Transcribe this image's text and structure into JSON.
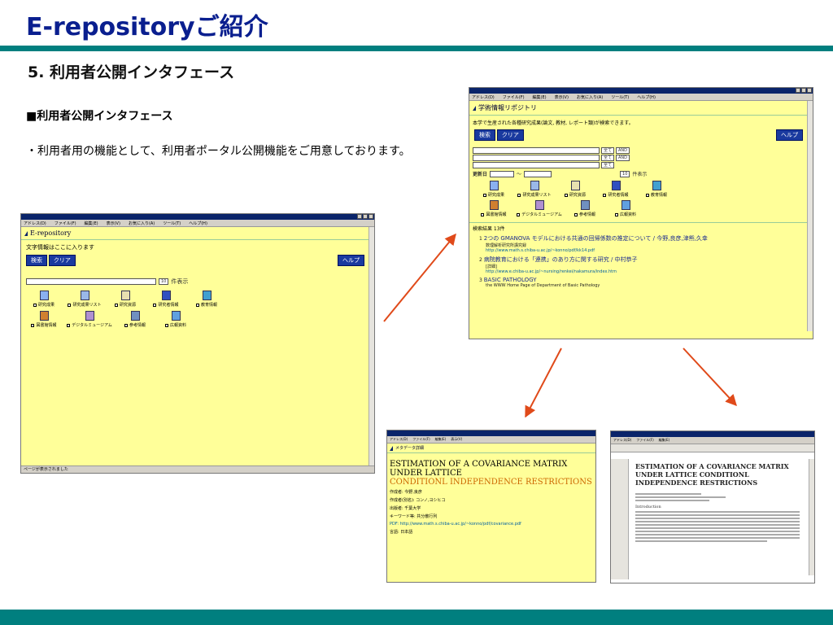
{
  "slide": {
    "title": "E-repositoryご紹介",
    "subtitle": "5. 利用者公開インタフェース",
    "section_head": "■利用者公開インタフェース",
    "bullet": "・利用者用の機能として、利用者ポータル公開機能をご用意しております。"
  },
  "colors": {
    "title": "#0a1f8f",
    "bar": "#007f7f",
    "arrow": "#e04a1a",
    "page_bg": "#ffff99"
  },
  "browser_menu": [
    "アドレス(D)",
    "ファイル(F)",
    "編集(E)",
    "表示(V)",
    "お気に入り(A)",
    "ツール(T)",
    "ヘルプ(H)"
  ],
  "shot_main": {
    "page_title": "E-repository",
    "prompt": "文字情報はここに入ります",
    "search_btn": "検索",
    "clear_btn": "クリア",
    "help_btn": "ヘルプ",
    "count_select": "10",
    "count_label": "件表示",
    "status": "ページが表示されました",
    "categories_row1": [
      "研究成果",
      "研究成果リスト",
      "研究資源",
      "研究者情報",
      "教育情報"
    ],
    "categories_row2": [
      "図書館情報",
      "デジタルミュージアム",
      "参考情報",
      "広報資料"
    ]
  },
  "shot_search": {
    "page_title": "学術情報リポジトリ",
    "description": "本学で生産された各種研究成果(論文, 教材, レポート類)が検索できます。",
    "search_btn": "検索",
    "clear_btn": "クリア",
    "help_btn": "ヘルプ",
    "select_all": "全て",
    "select_and": "AND",
    "date_label": "更新日",
    "range_sep": "〜",
    "count_select": "10",
    "count_label": "件表示",
    "categories_row1": [
      "研究成果",
      "研究成果リスト",
      "研究資源",
      "研究者情報",
      "教育情報"
    ],
    "categories_row2": [
      "図書館情報",
      "デジタルミュージアム",
      "参考情報",
      "広報資料"
    ],
    "results_label": "検索結果 13件",
    "results": [
      {
        "num": "1",
        "title": "2つの GMANOVA モデルにおける共通の回帰係数の推定について / 今野,良彦,津熊,久幸",
        "detail": "数理解析研究所講究録",
        "url": "http://www.math.s.chiba-u.ac.jp/~konno/pdf/kk14.pdf"
      },
      {
        "num": "2",
        "title": "病院教育における「連携」のあり方に関する研究 / 中村恭子",
        "detail": "[詳細]",
        "url": "http://www.e.chiba-u.ac.jp/~nursing/renkei/nakamura/index.htm"
      },
      {
        "num": "3",
        "title": "BASIC PATHOLOGY",
        "detail": "the WWW Home Page of Department of Basic Pathology",
        "url": ""
      }
    ]
  },
  "shot_detail": {
    "page_title": "メタデータ詳細",
    "title_line1": "ESTIMATION OF A COVARIANCE MATRIX UNDER LATTICE",
    "title_line2": "CONDITIONL INDEPENDENCE RESTRICTIONS",
    "rows": [
      "作成者: 今野,良彦",
      "作成者(別名): コンノ,ヨシヒコ",
      "出版者: 千葉大学",
      "キーワード等: 共分散行列",
      "PDF: http://www.math.s.chiba-u.ac.jp/~konno/pdf/covariance.pdf",
      "言語: 日本語"
    ]
  },
  "shot_pdf": {
    "title": "ESTIMATION OF A COVARIANCE MATRIX UNDER LATTICE CONDITIONL INDEPENDENCE RESTRICTIONS",
    "section": "Introduction"
  }
}
